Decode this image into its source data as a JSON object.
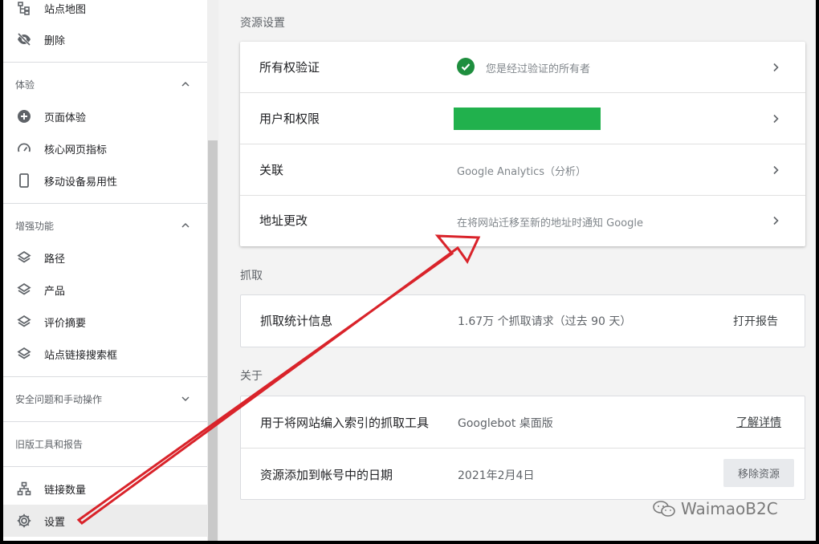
{
  "sidebar": {
    "top_items": [
      {
        "label": "站点地图",
        "icon": "sitemap-icon"
      },
      {
        "label": "删除",
        "icon": "eye-off-icon"
      }
    ],
    "sections": [
      {
        "title": "体验",
        "items": [
          {
            "label": "页面体验",
            "icon": "plus-circle-icon"
          },
          {
            "label": "核心网页指标",
            "icon": "gauge-icon"
          },
          {
            "label": "移动设备易用性",
            "icon": "phone-icon"
          }
        ]
      },
      {
        "title": "增强功能",
        "items": [
          {
            "label": "路径",
            "icon": "layers-icon"
          },
          {
            "label": "产品",
            "icon": "layers-icon"
          },
          {
            "label": "评价摘要",
            "icon": "layers-icon"
          },
          {
            "label": "站点链接搜索框",
            "icon": "layers-icon"
          }
        ]
      },
      {
        "title": "安全问题和手动操作"
      },
      {
        "title": "旧版工具和报告"
      }
    ],
    "bottom_items": [
      {
        "label": "链接数量",
        "icon": "network-icon"
      },
      {
        "label": "设置",
        "icon": "gear-icon"
      }
    ]
  },
  "main": {
    "resource_settings": {
      "title": "资源设置",
      "rows": [
        {
          "label": "所有权验证",
          "value": "您是经过验证的所有者"
        },
        {
          "label": "用户和权限",
          "value": ""
        },
        {
          "label": "关联",
          "value": "Google Analytics（分析）"
        },
        {
          "label": "地址更改",
          "value": "在将网站迁移至新的地址时通知 Google"
        }
      ]
    },
    "crawl": {
      "title": "抓取",
      "row": {
        "label": "抓取统计信息",
        "value": "1.67万 个抓取请求（过去 90 天）",
        "action": "打开报告"
      }
    },
    "about": {
      "title": "关于",
      "rows": [
        {
          "label": "用于将网站编入索引的抓取工具",
          "value": "Googlebot 桌面版",
          "action": "了解详情"
        },
        {
          "label": "资源添加到帐号中的日期",
          "value": "2021年2月4日",
          "action": "移除资源"
        }
      ]
    }
  },
  "watermark": "WaimaoB2C",
  "colors": {
    "verified": "#1e8e3e",
    "redaction": "#21b14d",
    "arrow": "#d9232a"
  }
}
